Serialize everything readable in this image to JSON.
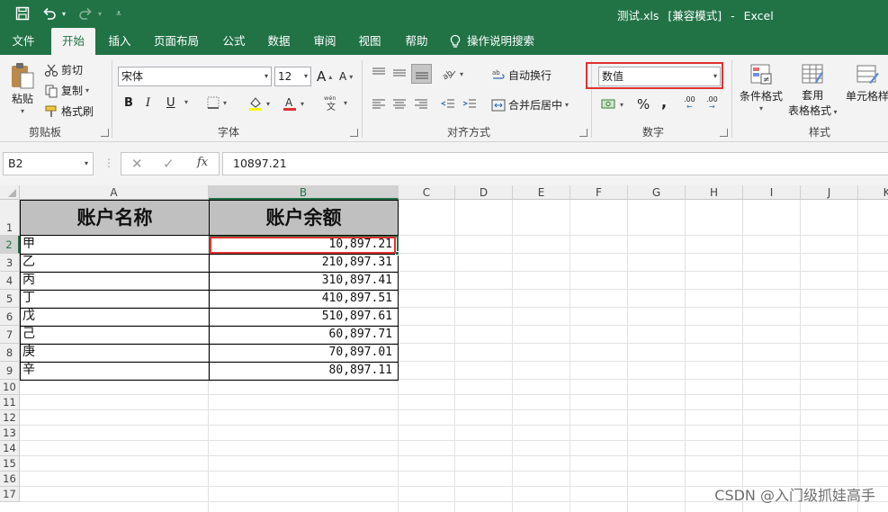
{
  "title_bar": {
    "filename": "测试.xls",
    "mode": "[兼容模式]",
    "separator": "-",
    "app": "Excel"
  },
  "tabs": [
    "文件",
    "开始",
    "插入",
    "页面布局",
    "公式",
    "数据",
    "审阅",
    "视图",
    "帮助",
    "操作说明搜索"
  ],
  "ribbon": {
    "clipboard": {
      "paste": "粘贴",
      "cut": "剪切",
      "copy": "复制",
      "format_painter": "格式刷",
      "label": "剪贴板"
    },
    "font": {
      "family": "宋体",
      "size": "12",
      "bold": "B",
      "italic": "I",
      "underline": "U",
      "grow": "A",
      "shrink": "A",
      "label": "字体"
    },
    "alignment": {
      "wrap": "自动换行",
      "merge": "合并后居中",
      "label": "对齐方式"
    },
    "number": {
      "format": "数值",
      "percent": "%",
      "comma": ",",
      "inc_decimal": ".00",
      "dec_decimal": ".00",
      "label": "数字"
    },
    "styles": {
      "conditional": "条件格式",
      "table_line1": "套用",
      "table_line2": "表格格式",
      "cell_styles": "单元格样",
      "label": "样式"
    }
  },
  "formula_bar": {
    "name_box": "B2",
    "formula": "10897.21"
  },
  "columns": [
    "A",
    "B",
    "C",
    "D",
    "E",
    "F",
    "G",
    "H",
    "I",
    "J",
    "K"
  ],
  "rows": [
    "1",
    "2",
    "3",
    "4",
    "5",
    "6",
    "7",
    "8",
    "9",
    "10",
    "11",
    "12",
    "13",
    "14",
    "15",
    "16",
    "17"
  ],
  "sheet": {
    "headers": {
      "A1": "账户名称",
      "B1": "账户余额"
    },
    "data": [
      {
        "name": "甲",
        "balance": "10,897.21"
      },
      {
        "name": "乙",
        "balance": "210,897.31"
      },
      {
        "name": "丙",
        "balance": "310,897.41"
      },
      {
        "name": "丁",
        "balance": "410,897.51"
      },
      {
        "name": "戊",
        "balance": "510,897.61"
      },
      {
        "name": "己",
        "balance": "60,897.71"
      },
      {
        "name": "庚",
        "balance": "70,897.01"
      },
      {
        "name": "辛",
        "balance": "80,897.11"
      }
    ]
  },
  "watermark": "CSDN @入门级抓娃高手",
  "colors": {
    "brand": "#217346",
    "highlight": "#e03131",
    "header_fill": "#c0c0c0"
  }
}
